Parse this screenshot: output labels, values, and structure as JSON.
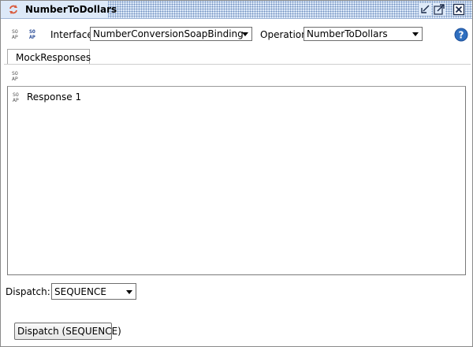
{
  "window": {
    "title": "NumberToDollars"
  },
  "toolbar": {
    "interface_label": "Interface",
    "interface_value": "NumberConversionSoapBinding",
    "operation_label": "Operation",
    "operation_value": "NumberToDollars"
  },
  "tabs": [
    {
      "label": "MockResponses"
    }
  ],
  "responses": [
    {
      "label": "Response 1"
    }
  ],
  "dispatch": {
    "label": "Dispatch:",
    "value": "SEQUENCE",
    "button_label": "Dispatch (SEQUENCE)"
  },
  "icons": {
    "title": "refresh-arrows-icon",
    "soap": "soap-icon",
    "help": "help-icon"
  },
  "colors": {
    "titlebar_bg": "#dde9f8",
    "titlebar_dots": "#6f8fbf",
    "help_blue": "#2f6fbf",
    "title_icon_red": "#d95a3c"
  }
}
